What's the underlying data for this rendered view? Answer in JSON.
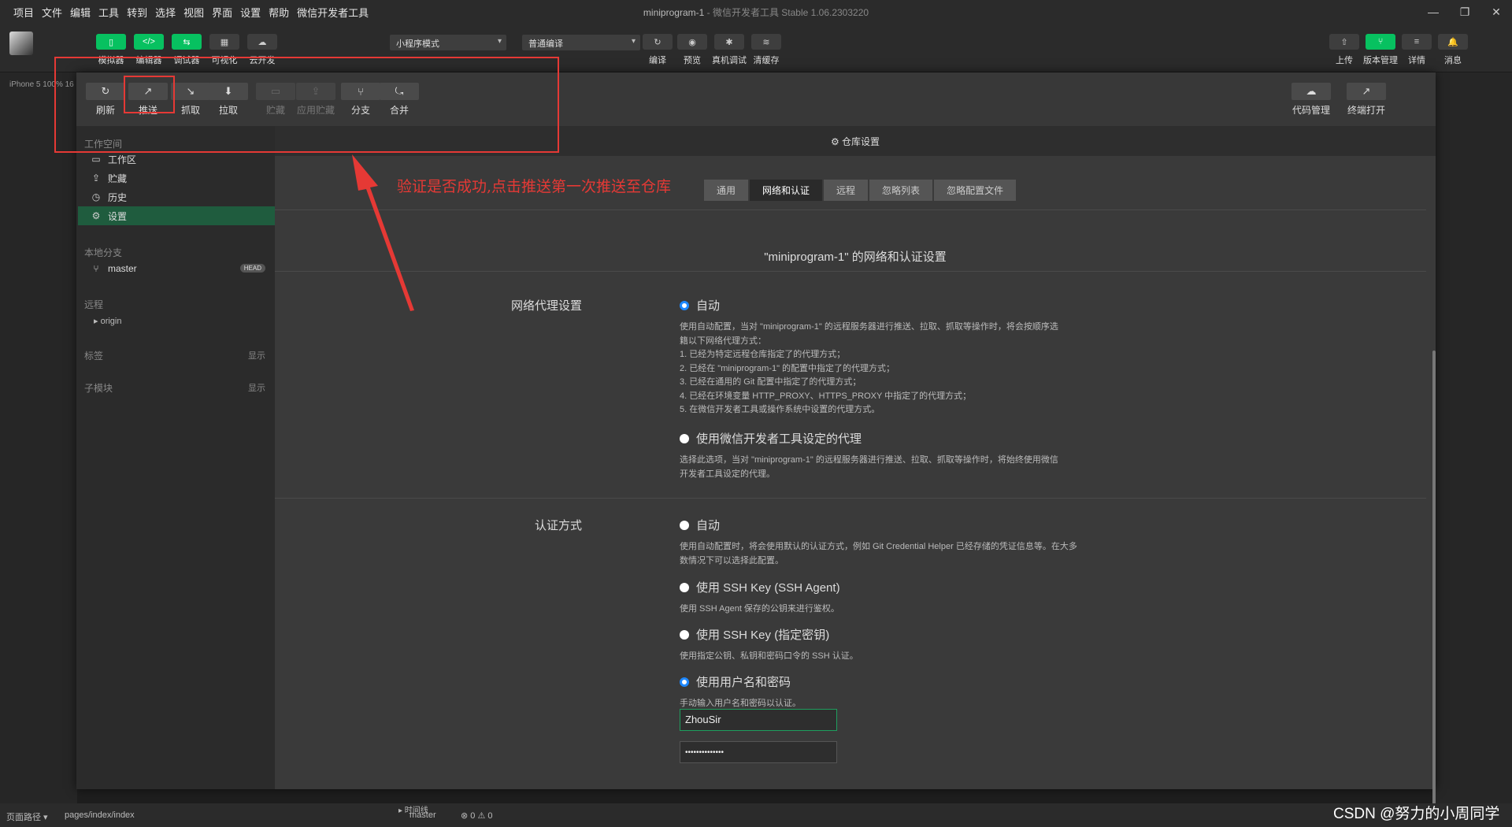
{
  "menu": [
    "项目",
    "文件",
    "编辑",
    "工具",
    "转到",
    "选择",
    "视图",
    "界面",
    "设置",
    "帮助",
    "微信开发者工具"
  ],
  "window_title": {
    "name": "miniprogram-1",
    "sep": " - ",
    "app": "微信开发者工具 Stable 1.06.2303220"
  },
  "window_controls": {
    "minimize": "—",
    "restore": "❐",
    "close": "✕"
  },
  "toolbar": {
    "left": [
      {
        "label": "模拟器",
        "icon": "▯"
      },
      {
        "label": "编辑器",
        "icon": "</>"
      },
      {
        "label": "调试器",
        "icon": "⇆"
      },
      {
        "label": "可视化",
        "icon": "▦"
      },
      {
        "label": "云开发",
        "icon": "☁"
      }
    ],
    "mode_select": "小程序模式",
    "compile_select": "普通编译",
    "middle": [
      {
        "label": "编译",
        "icon": "↻"
      },
      {
        "label": "预览",
        "icon": "◉"
      },
      {
        "label": "真机调试",
        "icon": "✱"
      },
      {
        "label": "清缓存",
        "icon": "≋"
      }
    ],
    "right": [
      {
        "label": "上传",
        "icon": "⇧"
      },
      {
        "label": "版本管理",
        "icon": "⑂"
      },
      {
        "label": "详情",
        "icon": "≡"
      },
      {
        "label": "消息",
        "icon": "🔔"
      }
    ]
  },
  "device_line": "iPhone 5 100% 16",
  "git": {
    "actions": [
      {
        "label": "刷新",
        "icon": "↻",
        "enabled": true
      },
      {
        "label": "推送",
        "icon": "↗",
        "enabled": true
      },
      {
        "label": "抓取",
        "icon": "↘",
        "enabled": true
      },
      {
        "label": "拉取",
        "icon": "⬇",
        "enabled": true
      },
      {
        "label": "贮藏",
        "icon": "▭",
        "enabled": false
      },
      {
        "label": "应用贮藏",
        "icon": "⇪",
        "enabled": false
      },
      {
        "label": "分支",
        "icon": "⑂",
        "enabled": true
      },
      {
        "label": "合并",
        "icon": "⤿",
        "enabled": true
      }
    ],
    "right_actions": [
      {
        "label": "代码管理",
        "icon": "☁"
      },
      {
        "label": "终端打开",
        "icon": "↗"
      }
    ],
    "sidebar": {
      "workspace_header": "工作空间",
      "workspace_items": [
        {
          "label": "工作区",
          "icon": "▭"
        },
        {
          "label": "贮藏",
          "icon": "⇪"
        },
        {
          "label": "历史",
          "icon": "◷"
        },
        {
          "label": "设置",
          "icon": "⚙",
          "active": true
        }
      ],
      "local_branch_header": "本地分支",
      "branch": "master",
      "head_badge": "HEAD",
      "remote_header": "远程",
      "remote": "▸ origin",
      "tags_header": "标签",
      "tags_show": "显示",
      "submodule_header": "子模块",
      "submodule_show": "显示"
    },
    "repo_settings": "⚙ 仓库设置",
    "tabs": [
      {
        "label": "通用",
        "active": false
      },
      {
        "label": "网络和认证",
        "active": true
      },
      {
        "label": "远程",
        "active": false
      },
      {
        "label": "忽略列表",
        "active": false
      },
      {
        "label": "忽略配置文件",
        "active": false
      }
    ],
    "panel_title": "\"miniprogram-1\" 的网络和认证设置",
    "proxy": {
      "label": "网络代理设置",
      "auto": "自动",
      "auto_desc": [
        "使用自动配置，当对 \"miniprogram-1\" 的远程服务器进行推送、拉取、抓取等操作时，将会按顺序选",
        "籍以下网络代理方式：",
        "1. 已经为特定远程仓库指定了的代理方式；",
        "2. 已经在 \"miniprogram-1\" 的配置中指定了的代理方式；",
        "3. 已经在通用的 Git 配置中指定了的代理方式；",
        "4. 已经在环境变量 HTTP_PROXY、HTTPS_PROXY 中指定了的代理方式；",
        "5. 在微信开发者工具或操作系统中设置的代理方式。"
      ],
      "wechat": "使用微信开发者工具设定的代理",
      "wechat_desc": [
        "选择此选项，当对 \"miniprogram-1\" 的远程服务器进行推送、拉取、抓取等操作时，将始终使用微信",
        "开发者工具设定的代理。"
      ],
      "selected": "auto"
    },
    "auth": {
      "label": "认证方式",
      "auto": "自动",
      "auto_desc": [
        "使用自动配置时，将会使用默认的认证方式，例如 Git Credential Helper 已经存储的凭证信息等。在大多",
        "数情况下可以选择此配置。"
      ],
      "ssh_agent": "使用 SSH Key (SSH Agent)",
      "ssh_agent_desc": "使用 SSH Agent 保存的公钥来进行鉴权。",
      "ssh_key": "使用 SSH Key (指定密钥)",
      "ssh_key_desc": "使用指定公钥、私钥和密码口令的 SSH 认证。",
      "userpass": "使用用户名和密码",
      "userpass_desc": "手动输入用户名和密码以认证。",
      "selected": "userpass",
      "username": "ZhouSir",
      "password": "••••••••••••••"
    }
  },
  "annotation": "验证是否成功,点击推送第一次推送至仓库",
  "bottom": {
    "page_path_label": "页面路径 ▾",
    "page_path": "pages/index/index",
    "timeline": "▸ 时间线",
    "branch": "master",
    "problems": "⊗ 0 ⚠ 0"
  },
  "watermark": "CSDN @努力的小周同学"
}
